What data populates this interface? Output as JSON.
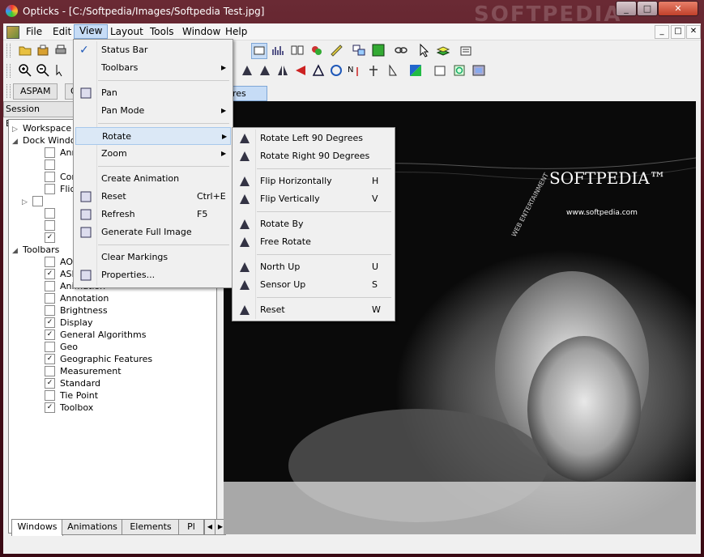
{
  "window": {
    "title": "Opticks - [C:/Softpedia/Images/Softpedia Test.jpg]",
    "watermark": "SOFTPEDIA",
    "controls": [
      "_",
      "□",
      "✕"
    ]
  },
  "menubar": {
    "items": [
      "File",
      "Edit",
      "View",
      "Layout",
      "Tools",
      "Window",
      "Help"
    ],
    "active": "View",
    "mdi_controls": [
      "_",
      "□",
      "✕"
    ]
  },
  "toolbar3": {
    "aspam_label": "ASPAM",
    "tab2_label": "G",
    "tab3_label": "res"
  },
  "session_explorer": {
    "title": "Session Explorer",
    "tree": [
      {
        "label": "Workspace",
        "level": 0,
        "expand": "▷"
      },
      {
        "label": "Dock Windo",
        "level": 0,
        "expand": "◢"
      },
      {
        "label": "Ann",
        "level": 1,
        "checked": false
      },
      {
        "label": "",
        "level": 1,
        "checked": false
      },
      {
        "label": "Con",
        "level": 1,
        "checked": false
      },
      {
        "label": "Flick",
        "level": 1,
        "checked": false
      },
      {
        "label": "",
        "level": 1,
        "checked": false,
        "expand": "▷"
      },
      {
        "label": "",
        "level": 1,
        "checked": false
      },
      {
        "label": "",
        "level": 1,
        "checked": false
      },
      {
        "label": "",
        "level": 1,
        "checked": true
      },
      {
        "label": "Toolbars",
        "level": 0,
        "expand": "◢"
      },
      {
        "label": "AOI",
        "level": 1,
        "checked": false
      },
      {
        "label": "ASPAM",
        "level": 1,
        "checked": true
      },
      {
        "label": "Animation",
        "level": 1,
        "checked": false
      },
      {
        "label": "Annotation",
        "level": 1,
        "checked": false
      },
      {
        "label": "Brightness",
        "level": 1,
        "checked": false
      },
      {
        "label": "Display",
        "level": 1,
        "checked": true
      },
      {
        "label": "General Algorithms",
        "level": 1,
        "checked": true
      },
      {
        "label": "Geo",
        "level": 1,
        "checked": false
      },
      {
        "label": "Geographic Features",
        "level": 1,
        "checked": true
      },
      {
        "label": "Measurement",
        "level": 1,
        "checked": false
      },
      {
        "label": "Standard",
        "level": 1,
        "checked": true
      },
      {
        "label": "Tie Point",
        "level": 1,
        "checked": false
      },
      {
        "label": "Toolbox",
        "level": 1,
        "checked": true
      }
    ],
    "tabs": [
      "Windows",
      "Animations",
      "Elements",
      "Pl"
    ]
  },
  "view_menu": {
    "items": [
      {
        "label": "Status Bar",
        "checked": true,
        "shortcut": "",
        "submenu": false
      },
      {
        "label": "Toolbars",
        "shortcut": "",
        "submenu": true
      },
      {
        "sep": true
      },
      {
        "label": "Pan",
        "shortcut": "",
        "submenu": false,
        "icon": "hand-icon"
      },
      {
        "label": "Pan Mode",
        "shortcut": "",
        "submenu": true
      },
      {
        "sep": true
      },
      {
        "label": "Rotate",
        "shortcut": "",
        "submenu": true,
        "highlighted": true
      },
      {
        "label": "Zoom",
        "shortcut": "",
        "submenu": true
      },
      {
        "sep": true
      },
      {
        "label": "Create Animation",
        "shortcut": "",
        "submenu": false
      },
      {
        "label": "Reset",
        "shortcut": "Ctrl+E",
        "submenu": false,
        "icon": "reset-icon"
      },
      {
        "label": "Refresh",
        "shortcut": "F5",
        "submenu": false,
        "icon": "refresh-icon"
      },
      {
        "label": "Generate Full Image",
        "shortcut": "",
        "submenu": false,
        "icon": "full-image-icon"
      },
      {
        "sep": true
      },
      {
        "label": "Clear Markings",
        "shortcut": "",
        "submenu": false
      },
      {
        "label": "Properties...",
        "shortcut": "",
        "submenu": false,
        "icon": "properties-icon"
      }
    ]
  },
  "rotate_menu": {
    "items": [
      {
        "label": "Rotate Left 90 Degrees",
        "shortcut": ""
      },
      {
        "label": "Rotate Right 90 Degrees",
        "shortcut": ""
      },
      {
        "sep": true
      },
      {
        "label": "Flip Horizontally",
        "shortcut": "H"
      },
      {
        "label": "Flip Vertically",
        "shortcut": "V"
      },
      {
        "sep": true
      },
      {
        "label": "Rotate By",
        "shortcut": ""
      },
      {
        "label": "Free Rotate",
        "shortcut": ""
      },
      {
        "sep": true
      },
      {
        "label": "North Up",
        "shortcut": "U"
      },
      {
        "label": "Sensor Up",
        "shortcut": "S"
      },
      {
        "sep": true
      },
      {
        "label": "Reset",
        "shortcut": "W"
      }
    ]
  },
  "image": {
    "brand": "SOFTPEDIA",
    "tm": "™",
    "url": "www.softpedia.com",
    "arc_text": "WEB  ENTERTAINMENT"
  },
  "colors": {
    "frame": "#5a1420",
    "highlight": "#dbe8f6",
    "check": "#1f58b8"
  }
}
